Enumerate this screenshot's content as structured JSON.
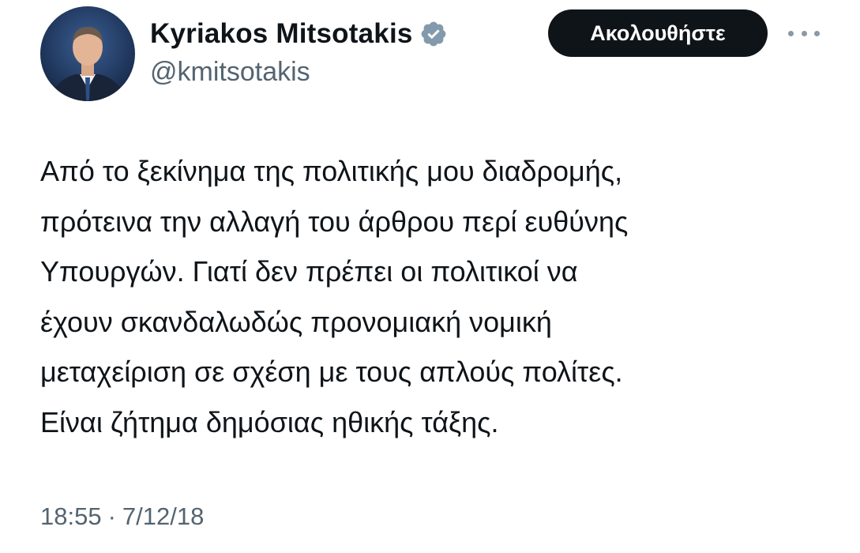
{
  "author": {
    "display_name": "Kyriakos Mitsotakis",
    "handle": "@kmitsotakis",
    "verified_icon": "verified-badge-icon"
  },
  "actions": {
    "follow_label": "Ακολουθήστε",
    "more_icon": "more-options-icon"
  },
  "tweet": {
    "lines": [
      "Από το ξεκίνημα της πολιτικής μου διαδρομής,",
      "πρότεινα την αλλαγή του άρθρου περί ευθύνης",
      "Υπουργών. Γιατί δεν πρέπει οι πολιτικοί να",
      "έχουν σκανδαλωδώς προνομιακή νομική",
      "μεταχείριση σε σχέση με τους απλούς πολίτες.",
      "Είναι ζήτημα δημόσιας ηθικής τάξης."
    ]
  },
  "meta": {
    "time": "18:55",
    "separator": "·",
    "date": "7/12/18"
  },
  "colors": {
    "text_primary": "#0f1419",
    "text_secondary": "#536471",
    "button_bg": "#0f1419",
    "button_text": "#ffffff",
    "verified_badge": "#829aab"
  }
}
